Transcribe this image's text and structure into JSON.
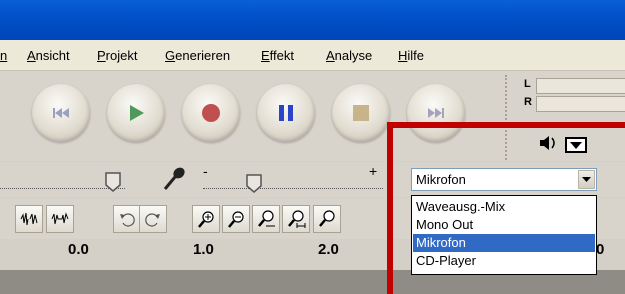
{
  "menubar": {
    "items": [
      {
        "label": "n"
      },
      {
        "label": "Ansicht"
      },
      {
        "label": "Projekt"
      },
      {
        "label": "Generieren"
      },
      {
        "label": "Effekt"
      },
      {
        "label": "Analyse"
      },
      {
        "label": "Hilfe"
      }
    ]
  },
  "transport": {
    "buttons": [
      {
        "name": "skip-to-start",
        "icon": "skip-start-icon"
      },
      {
        "name": "play",
        "icon": "play-icon",
        "color": "#4e9a58"
      },
      {
        "name": "record",
        "icon": "record-icon",
        "color": "#c0504d"
      },
      {
        "name": "pause",
        "icon": "pause-icon",
        "color": "#2a46c8"
      },
      {
        "name": "stop",
        "icon": "stop-icon",
        "color": "#c8b48a"
      },
      {
        "name": "skip-to-end",
        "icon": "skip-end-icon"
      }
    ]
  },
  "meter": {
    "left_label": "L",
    "right_label": "R"
  },
  "mixer": {
    "minus_label": "-",
    "plus_label": "+"
  },
  "input_source": {
    "selected": "Mikrofon",
    "options": [
      "Waveausg.-Mix",
      "Mono Out",
      "Mikrofon",
      "CD-Player"
    ],
    "highlighted_index": 2
  },
  "ruler": {
    "labels": [
      "0.0",
      "1.0",
      "2.0",
      "0"
    ]
  },
  "colors": {
    "title_blue": "#0054e3",
    "highlight": "#316ac5",
    "annotation_red": "#c10000"
  }
}
